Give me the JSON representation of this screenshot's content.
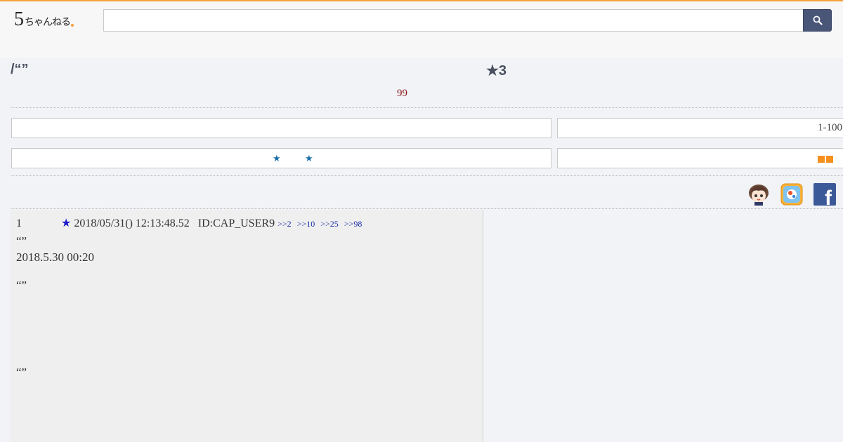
{
  "header": {
    "logo_five": "5",
    "logo_kana": "ちゃんねる",
    "search_value": "",
    "search_icon": "search-icon",
    "accent_color": "#f5a03a"
  },
  "thread": {
    "title": "/“”",
    "star_label": "★3",
    "res_count": "99"
  },
  "nav": {
    "page_range": "1-100",
    "star_left": "★",
    "star_right": "★"
  },
  "share": {
    "icons": [
      "character-avatar-icon",
      "app-badge-icon",
      "facebook-icon"
    ],
    "facebook_letter": "f"
  },
  "post": {
    "number": "1",
    "star": "★",
    "datetime": "2018/05/31() 12:13:48.52",
    "id": "ID:CAP_USER9",
    "anchors": [
      ">>2",
      ">>10",
      ">>25",
      ">>98"
    ],
    "lines": [
      "“”",
      "2018.5.30 00:20",
      "“”",
      "“”"
    ]
  }
}
